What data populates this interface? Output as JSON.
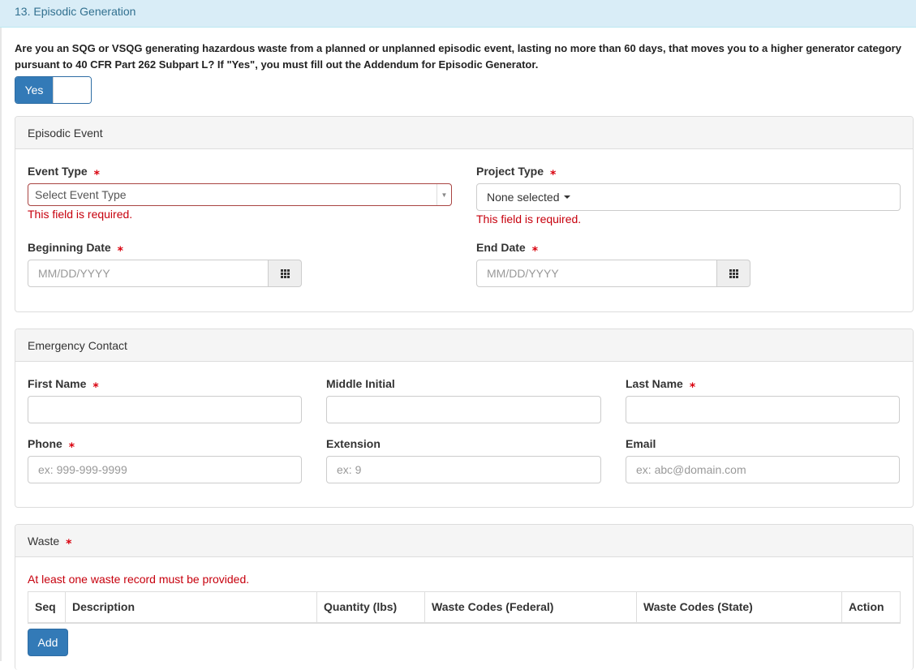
{
  "section": {
    "title": "13. Episodic Generation"
  },
  "question": "Are you an SQG or VSQG generating hazardous waste from a planned or unplanned episodic event, lasting no more than 60 days, that moves you to a higher generator category pursuant to 40 CFR Part 262 Subpart L? If \"Yes\", you must fill out the Addendum for Episodic Generator.",
  "toggle": {
    "label": "Yes"
  },
  "required_mark": "⁎",
  "episodic_event": {
    "heading": "Episodic Event",
    "event_type": {
      "label": "Event Type",
      "placeholder": "Select Event Type",
      "error": "This field is required."
    },
    "project_type": {
      "label": "Project Type",
      "value": "None selected",
      "error": "This field is required."
    },
    "beginning_date": {
      "label": "Beginning Date",
      "placeholder": "MM/DD/YYYY"
    },
    "end_date": {
      "label": "End Date",
      "placeholder": "MM/DD/YYYY"
    }
  },
  "emergency_contact": {
    "heading": "Emergency Contact",
    "first_name": {
      "label": "First Name",
      "value": ""
    },
    "middle_initial": {
      "label": "Middle Initial",
      "value": ""
    },
    "last_name": {
      "label": "Last Name",
      "value": ""
    },
    "phone": {
      "label": "Phone",
      "placeholder": "ex: 999-999-9999"
    },
    "extension": {
      "label": "Extension",
      "placeholder": "ex: 9"
    },
    "email": {
      "label": "Email",
      "placeholder": "ex: abc@domain.com"
    }
  },
  "waste": {
    "heading": "Waste",
    "error": "At least one waste record must be provided.",
    "columns": [
      "Seq",
      "Description",
      "Quantity (lbs)",
      "Waste Codes (Federal)",
      "Waste Codes (State)",
      "Action"
    ],
    "add_label": "Add"
  },
  "colors": {
    "primary": "#337ab7",
    "error": "#c7000d",
    "header_bg": "#d9edf7"
  }
}
